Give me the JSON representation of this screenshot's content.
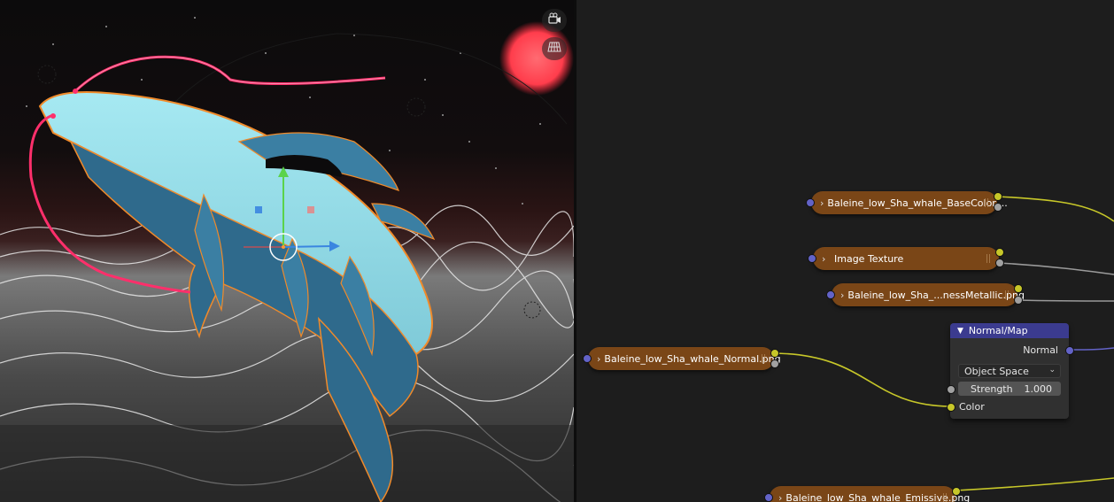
{
  "viewport": {
    "buttons": [
      {
        "name": "camera-view",
        "icon": "camera-icon"
      },
      {
        "name": "grid-view",
        "icon": "grid-icon"
      }
    ]
  },
  "node_editor": {
    "nodes": [
      {
        "label": "Baleine_low_Sha_whale_BaseColor....",
        "icon": "chevron-right-icon"
      },
      {
        "label": "Image Texture",
        "icon": "chevron-right-icon"
      },
      {
        "label": "Baleine_low_Sha_...nessMetallic.png",
        "icon": "chevron-right-icon"
      },
      {
        "label": "Baleine_low_Sha_whale_Normal.png",
        "icon": "chevron-right-icon"
      },
      {
        "label": "Baleine_low_Sha_whale_Emissive.png",
        "icon": "chevron-right-icon"
      }
    ],
    "normal_map": {
      "title": "Normal/Map",
      "output_label": "Normal",
      "space_value": "Object Space",
      "strength_label": "Strength",
      "strength_value": "1.000",
      "color_label": "Color"
    },
    "colors": {
      "image_node": "#7a4617",
      "vector_node_header": "#3b3b8f",
      "color_socket": "#c7c729",
      "float_socket": "#a1a1a1",
      "vector_socket": "#6363c7"
    }
  }
}
